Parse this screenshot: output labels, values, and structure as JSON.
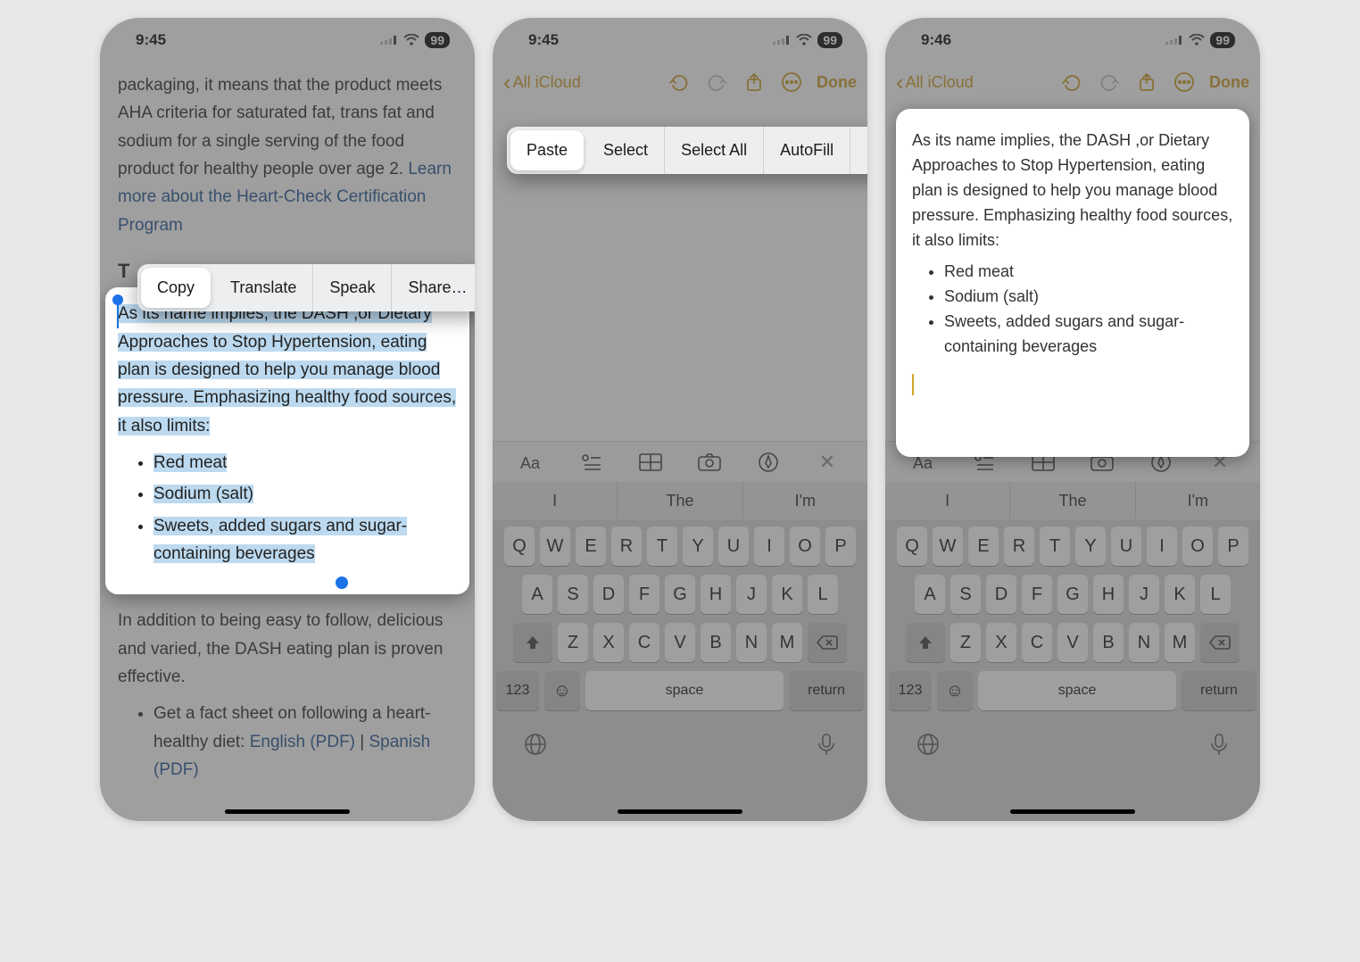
{
  "status": {
    "time1": "9:45",
    "time2": "9:45",
    "time3": "9:46",
    "battery": "99"
  },
  "article": {
    "top_text": "packaging, it means that the product meets AHA criteria for saturated fat, trans fat and sodium for a single serving of the food product for healthy people over age 2. ",
    "link1": "Learn more about the Heart-Check Certification Program",
    "heading_prefix": "T",
    "selected_para": "As its name implies, the DASH ,or Dietary Approaches to Stop Hypertension, eating plan is designed to help you manage blood pressure. Emphasizing healthy food sources, it also limits:",
    "bullets": [
      "Red meat",
      "Sodium (salt)",
      "Sweets, added sugars and sugar-containing beverages"
    ],
    "after_para": "In addition to being easy to follow, delicious and varied, the DASH eating plan is proven effective.",
    "fact_prefix": "Get a fact sheet on following a heart-healthy diet:  ",
    "fact_en": "English (PDF)",
    "fact_sep": " | ",
    "fact_es": "Spanish (PDF)"
  },
  "ctx1": {
    "copy": "Copy",
    "translate": "Translate",
    "speak": "Speak",
    "share": "Share…"
  },
  "ctx2": {
    "paste": "Paste",
    "select": "Select",
    "select_all": "Select All",
    "autofill": "AutoFill"
  },
  "notes_tb": {
    "back": "All iCloud",
    "done": "Done"
  },
  "pred": {
    "a": "I",
    "b": "The",
    "c": "I'm"
  },
  "keys": {
    "r1": [
      "Q",
      "W",
      "E",
      "R",
      "T",
      "Y",
      "U",
      "I",
      "O",
      "P"
    ],
    "r2": [
      "A",
      "S",
      "D",
      "F",
      "G",
      "H",
      "J",
      "K",
      "L"
    ],
    "r3": [
      "Z",
      "X",
      "C",
      "V",
      "B",
      "N",
      "M"
    ],
    "num": "123",
    "space": "space",
    "return": "return"
  },
  "note3": {
    "para": "As its name implies, the DASH ,or Dietary Approaches to Stop Hypertension, eating plan is designed to help you manage blood pressure. Emphasizing healthy food sources, it also limits:",
    "bullets": [
      "Red meat",
      "Sodium (salt)",
      "Sweets, added sugars and sugar-containing beverages"
    ]
  }
}
